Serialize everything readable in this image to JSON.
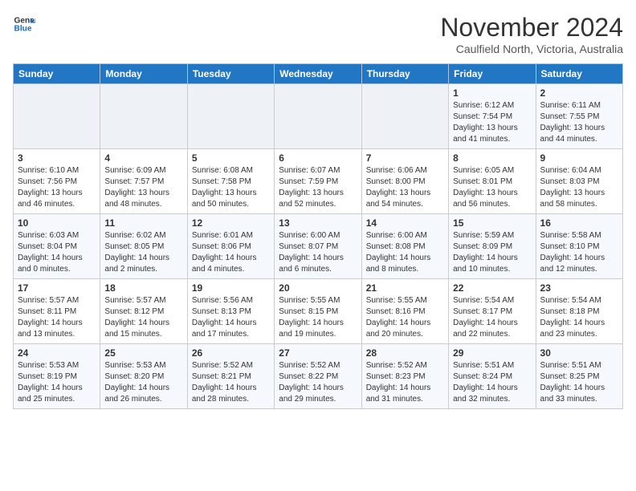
{
  "header": {
    "logo_line1": "General",
    "logo_line2": "Blue",
    "title": "November 2024",
    "subtitle": "Caulfield North, Victoria, Australia"
  },
  "weekdays": [
    "Sunday",
    "Monday",
    "Tuesday",
    "Wednesday",
    "Thursday",
    "Friday",
    "Saturday"
  ],
  "weeks": [
    [
      {
        "day": "",
        "info": ""
      },
      {
        "day": "",
        "info": ""
      },
      {
        "day": "",
        "info": ""
      },
      {
        "day": "",
        "info": ""
      },
      {
        "day": "",
        "info": ""
      },
      {
        "day": "1",
        "info": "Sunrise: 6:12 AM\nSunset: 7:54 PM\nDaylight: 13 hours\nand 41 minutes."
      },
      {
        "day": "2",
        "info": "Sunrise: 6:11 AM\nSunset: 7:55 PM\nDaylight: 13 hours\nand 44 minutes."
      }
    ],
    [
      {
        "day": "3",
        "info": "Sunrise: 6:10 AM\nSunset: 7:56 PM\nDaylight: 13 hours\nand 46 minutes."
      },
      {
        "day": "4",
        "info": "Sunrise: 6:09 AM\nSunset: 7:57 PM\nDaylight: 13 hours\nand 48 minutes."
      },
      {
        "day": "5",
        "info": "Sunrise: 6:08 AM\nSunset: 7:58 PM\nDaylight: 13 hours\nand 50 minutes."
      },
      {
        "day": "6",
        "info": "Sunrise: 6:07 AM\nSunset: 7:59 PM\nDaylight: 13 hours\nand 52 minutes."
      },
      {
        "day": "7",
        "info": "Sunrise: 6:06 AM\nSunset: 8:00 PM\nDaylight: 13 hours\nand 54 minutes."
      },
      {
        "day": "8",
        "info": "Sunrise: 6:05 AM\nSunset: 8:01 PM\nDaylight: 13 hours\nand 56 minutes."
      },
      {
        "day": "9",
        "info": "Sunrise: 6:04 AM\nSunset: 8:03 PM\nDaylight: 13 hours\nand 58 minutes."
      }
    ],
    [
      {
        "day": "10",
        "info": "Sunrise: 6:03 AM\nSunset: 8:04 PM\nDaylight: 14 hours\nand 0 minutes."
      },
      {
        "day": "11",
        "info": "Sunrise: 6:02 AM\nSunset: 8:05 PM\nDaylight: 14 hours\nand 2 minutes."
      },
      {
        "day": "12",
        "info": "Sunrise: 6:01 AM\nSunset: 8:06 PM\nDaylight: 14 hours\nand 4 minutes."
      },
      {
        "day": "13",
        "info": "Sunrise: 6:00 AM\nSunset: 8:07 PM\nDaylight: 14 hours\nand 6 minutes."
      },
      {
        "day": "14",
        "info": "Sunrise: 6:00 AM\nSunset: 8:08 PM\nDaylight: 14 hours\nand 8 minutes."
      },
      {
        "day": "15",
        "info": "Sunrise: 5:59 AM\nSunset: 8:09 PM\nDaylight: 14 hours\nand 10 minutes."
      },
      {
        "day": "16",
        "info": "Sunrise: 5:58 AM\nSunset: 8:10 PM\nDaylight: 14 hours\nand 12 minutes."
      }
    ],
    [
      {
        "day": "17",
        "info": "Sunrise: 5:57 AM\nSunset: 8:11 PM\nDaylight: 14 hours\nand 13 minutes."
      },
      {
        "day": "18",
        "info": "Sunrise: 5:57 AM\nSunset: 8:12 PM\nDaylight: 14 hours\nand 15 minutes."
      },
      {
        "day": "19",
        "info": "Sunrise: 5:56 AM\nSunset: 8:13 PM\nDaylight: 14 hours\nand 17 minutes."
      },
      {
        "day": "20",
        "info": "Sunrise: 5:55 AM\nSunset: 8:15 PM\nDaylight: 14 hours\nand 19 minutes."
      },
      {
        "day": "21",
        "info": "Sunrise: 5:55 AM\nSunset: 8:16 PM\nDaylight: 14 hours\nand 20 minutes."
      },
      {
        "day": "22",
        "info": "Sunrise: 5:54 AM\nSunset: 8:17 PM\nDaylight: 14 hours\nand 22 minutes."
      },
      {
        "day": "23",
        "info": "Sunrise: 5:54 AM\nSunset: 8:18 PM\nDaylight: 14 hours\nand 23 minutes."
      }
    ],
    [
      {
        "day": "24",
        "info": "Sunrise: 5:53 AM\nSunset: 8:19 PM\nDaylight: 14 hours\nand 25 minutes."
      },
      {
        "day": "25",
        "info": "Sunrise: 5:53 AM\nSunset: 8:20 PM\nDaylight: 14 hours\nand 26 minutes."
      },
      {
        "day": "26",
        "info": "Sunrise: 5:52 AM\nSunset: 8:21 PM\nDaylight: 14 hours\nand 28 minutes."
      },
      {
        "day": "27",
        "info": "Sunrise: 5:52 AM\nSunset: 8:22 PM\nDaylight: 14 hours\nand 29 minutes."
      },
      {
        "day": "28",
        "info": "Sunrise: 5:52 AM\nSunset: 8:23 PM\nDaylight: 14 hours\nand 31 minutes."
      },
      {
        "day": "29",
        "info": "Sunrise: 5:51 AM\nSunset: 8:24 PM\nDaylight: 14 hours\nand 32 minutes."
      },
      {
        "day": "30",
        "info": "Sunrise: 5:51 AM\nSunset: 8:25 PM\nDaylight: 14 hours\nand 33 minutes."
      }
    ]
  ]
}
